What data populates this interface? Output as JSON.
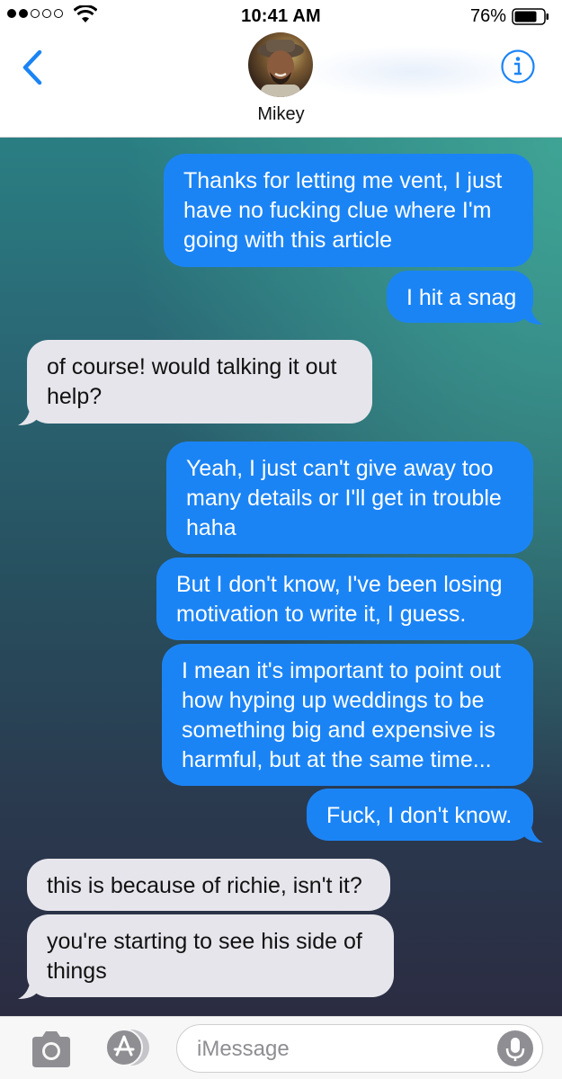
{
  "status_bar": {
    "time": "10:41 AM",
    "battery_percent": "76%",
    "signal_bars_filled": 2,
    "signal_bars_total": 5
  },
  "header": {
    "contact_name": "Mikey",
    "back_icon": "chevron-left-icon",
    "info_icon": "info-icon"
  },
  "messages": [
    {
      "direction": "outgoing",
      "lines": [
        "Thanks for letting me vent, I just",
        "have no fucking clue where I'm",
        "going with this article"
      ]
    },
    {
      "direction": "outgoing",
      "lines": [
        "I hit a snag"
      ]
    },
    {
      "direction": "incoming",
      "lines": [
        "of course! would talking it out",
        "help?"
      ]
    },
    {
      "direction": "outgoing",
      "lines": [
        "Yeah, I just can't give away too",
        "many details or I'll get in trouble",
        "haha"
      ]
    },
    {
      "direction": "outgoing",
      "lines": [
        "But I don't know, I've been losing",
        "motivation to write it, I guess."
      ]
    },
    {
      "direction": "outgoing",
      "lines": [
        "I mean it's important to point out",
        "how hyping up weddings to be",
        "something big and expensive is",
        "harmful, but at the same time..."
      ]
    },
    {
      "direction": "outgoing",
      "lines": [
        "Fuck, I don't know."
      ]
    },
    {
      "direction": "incoming",
      "lines": [
        "this is because of richie, isn't it?"
      ]
    },
    {
      "direction": "incoming",
      "lines": [
        "you're starting to see his side of",
        "things"
      ]
    }
  ],
  "input_bar": {
    "placeholder": "iMessage",
    "camera_icon": "camera-icon",
    "apps_icon": "app-store-icon",
    "mic_icon": "microphone-icon"
  },
  "colors": {
    "outgoing_bubble": "#1b84f5",
    "incoming_bubble": "#e6e5eb",
    "accent": "#1b84f5"
  }
}
